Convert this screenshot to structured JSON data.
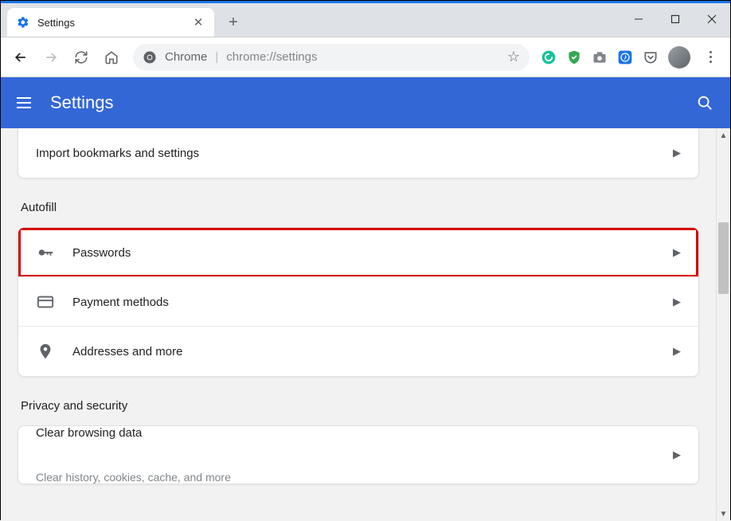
{
  "tab": {
    "title": "Settings"
  },
  "omnibox": {
    "origin": "Chrome",
    "url": "chrome://settings"
  },
  "appbar": {
    "title": "Settings"
  },
  "topcard": {
    "import_label": "Import bookmarks and settings"
  },
  "sections": {
    "autofill": {
      "title": "Autofill",
      "rows": [
        {
          "label": "Passwords"
        },
        {
          "label": "Payment methods"
        },
        {
          "label": "Addresses and more"
        }
      ]
    },
    "privacy": {
      "title": "Privacy and security",
      "rows": [
        {
          "label": "Clear browsing data",
          "sub": "Clear history, cookies, cache, and more"
        }
      ]
    }
  }
}
